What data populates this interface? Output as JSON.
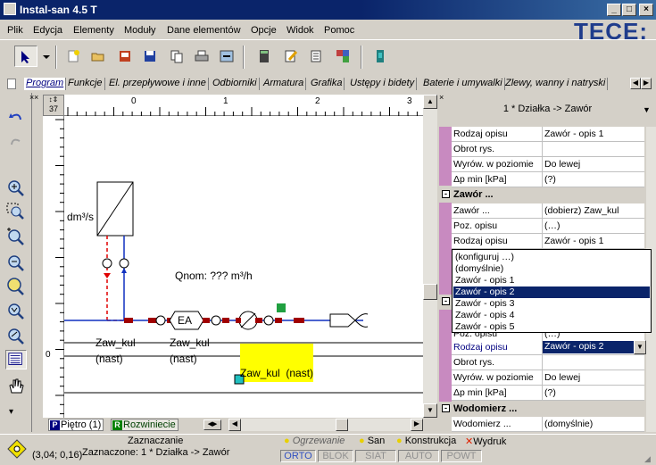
{
  "window": {
    "title": "Instal-san 4.5 T"
  },
  "menu": [
    "Plik",
    "Edycja",
    "Elementy",
    "Moduły",
    "Dane elementów",
    "Opcje",
    "Widok",
    "Pomoc"
  ],
  "brand": {
    "logo": "TECE:",
    "color": "#1f3c8c"
  },
  "tabs": [
    "Program",
    "Funkcje",
    "El. przepływowe i inne",
    "Odbiorniki",
    "Armatura",
    "Grafika",
    "Ustępy i bidety",
    "Baterie i umywalki",
    "Zlewy, wanny i natryski"
  ],
  "ruler": {
    "corner": "37",
    "ticks": [
      "0",
      "1",
      "2",
      "3"
    ],
    "vticks": [
      "0"
    ]
  },
  "canvas": {
    "label_flow_unit": "dm³/s",
    "label_qnom": "Qnom: ??? m³/h",
    "label_ea": "EA",
    "valve1_name": "Zaw_kul",
    "valve1_state": "(nast)",
    "valve2_name": "Zaw_kul",
    "valve2_state": "(nast)",
    "selected_label": "Zaw_kul  (nast)"
  },
  "bottom_tabs": [
    {
      "badge": "P",
      "label": "Piętro (1)"
    },
    {
      "badge": "R",
      "label": "Rozwiniecie"
    }
  ],
  "panel": {
    "header": "1 * Działka -> Zawór",
    "rows_top": [
      {
        "key": "Rodzaj opisu",
        "value": "Zawór - opis 1"
      },
      {
        "key": "Obrot rys.",
        "value": ""
      },
      {
        "key": "Wyrów. w poziomie",
        "value": "Do lewej"
      },
      {
        "key": "Δp min [kPa]",
        "value": "(?)"
      }
    ],
    "section_valve": "Zawór ...",
    "rows_valve": [
      {
        "key": "Zawór ...",
        "value": "(dobierz) Zaw_kul"
      },
      {
        "key": "Poz. opisu",
        "value": "(…)"
      },
      {
        "key": "Rodzaj opisu",
        "value": "Zawór - opis 1"
      }
    ],
    "dropdown_options": [
      "(konfiguruj …)",
      "(domyślnie)",
      "Zawór - opis 1",
      "Zawór - opis 2",
      "Zawór - opis 3",
      "Zawór - opis 4",
      "Zawór - opis 5"
    ],
    "dropdown_selected": "Zawór - opis 2",
    "row_poz": {
      "key": "Poz. opisu",
      "value": "(…)"
    },
    "row_rodzaj_active": {
      "key": "Rodzaj opisu",
      "value": "Zawór - opis 2"
    },
    "rows_bottom": [
      {
        "key": "Obrot rys.",
        "value": ""
      },
      {
        "key": "Wyrów. w poziomie",
        "value": "Do lewej"
      },
      {
        "key": "Δp min [kPa]",
        "value": "(?)"
      }
    ],
    "section_meter": "Wodomierz ...",
    "row_meter": {
      "key": "Wodomierz ...",
      "value": "(domyślnie)"
    }
  },
  "status": {
    "mode": "Zaznaczanie",
    "coords": "(3,04; 0,16)",
    "selection": "Zaznaczone: 1 * Działka -> Zawór",
    "layers": [
      "Ogrzewanie",
      "San",
      "Konstrukcja",
      "Wydruk"
    ],
    "toggles": [
      "ORTO",
      "BLOK",
      "SIAT",
      "AUTO",
      "POWT"
    ]
  }
}
